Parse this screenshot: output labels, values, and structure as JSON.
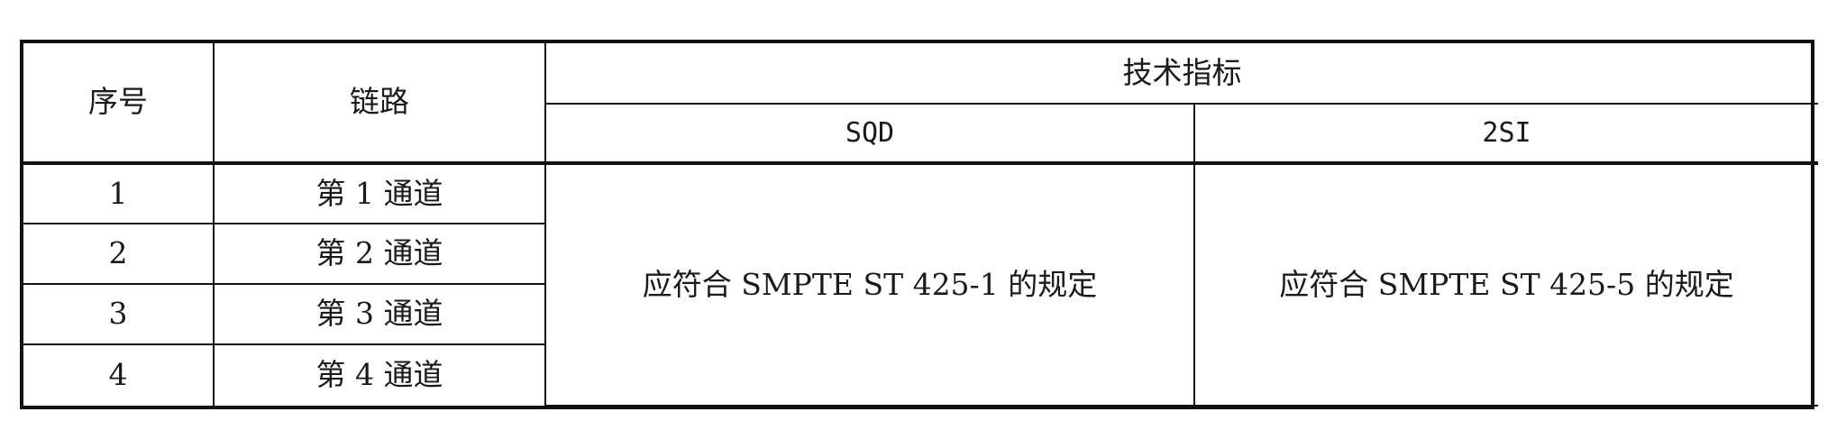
{
  "table": {
    "headers": {
      "index": "序号",
      "link": "链路",
      "group": "技术指标",
      "sqd": "SQD",
      "two_si": "2SI"
    },
    "rows": [
      {
        "index": "1",
        "link": "第 1 通道"
      },
      {
        "index": "2",
        "link": "第 2 通道"
      },
      {
        "index": "3",
        "link": "第 3 通道"
      },
      {
        "index": "4",
        "link": "第 4 通道"
      }
    ],
    "sqd_spec": "应符合 SMPTE ST 425-1 的规定",
    "two_si_spec": "应符合 SMPTE ST 425-5 的规定"
  }
}
